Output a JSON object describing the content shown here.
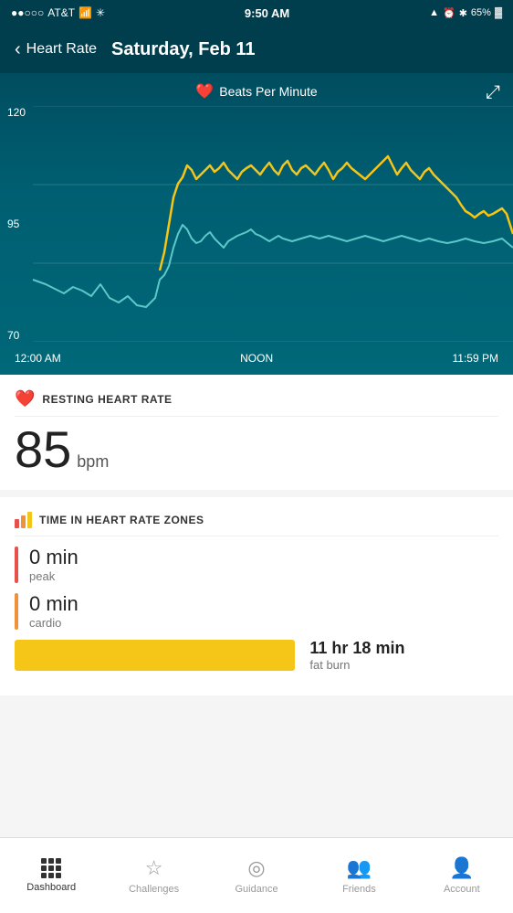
{
  "statusBar": {
    "carrier": "AT&T",
    "time": "9:50 AM",
    "battery": "65%"
  },
  "header": {
    "backLabel": "Heart Rate",
    "title": "Saturday, Feb 11"
  },
  "chart": {
    "legend": "Beats Per Minute",
    "yLabels": [
      "120",
      "95",
      "70"
    ],
    "xLabels": [
      "12:00 AM",
      "NOON",
      "11:59 PM"
    ]
  },
  "restingHeartRate": {
    "sectionTitle": "RESTING HEART RATE",
    "value": "85",
    "unit": "bpm"
  },
  "heartRateZones": {
    "sectionTitle": "TIME IN HEART RATE ZONES",
    "zones": [
      {
        "label": "peak",
        "value": "0 min",
        "color": "#e8504a"
      },
      {
        "label": "cardio",
        "value": "0 min",
        "color": "#f0923c"
      },
      {
        "label": "fat burn",
        "value": "11 hr 18 min",
        "color": "#f5c518"
      }
    ]
  },
  "bottomNav": {
    "items": [
      {
        "label": "Dashboard",
        "active": true
      },
      {
        "label": "Challenges",
        "active": false
      },
      {
        "label": "Guidance",
        "active": false
      },
      {
        "label": "Friends",
        "active": false
      },
      {
        "label": "Account",
        "active": false
      }
    ]
  }
}
